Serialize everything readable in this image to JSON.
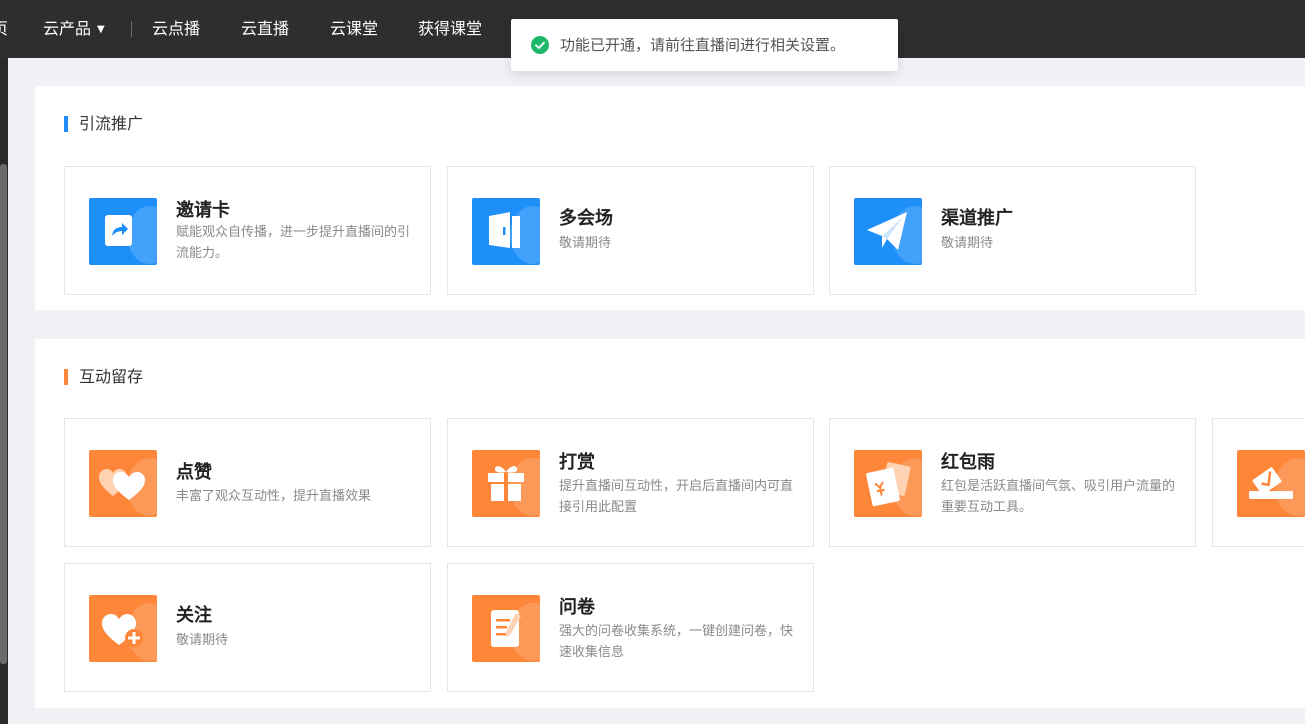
{
  "nav": {
    "items": [
      {
        "label": "页"
      },
      {
        "label": "云产品"
      },
      {
        "label": "云点播"
      },
      {
        "label": "云直播"
      },
      {
        "label": "云课堂"
      },
      {
        "label": "获得课堂"
      }
    ],
    "caret": "▼"
  },
  "toast": {
    "message": "功能已开通，请前往直播间进行相关设置。",
    "icon": "check-circle-icon",
    "color": "#1fb86b"
  },
  "sections": [
    {
      "title": "引流推广",
      "accent": "#1e8ff9",
      "cards": [
        {
          "title": "邀请卡",
          "desc": "赋能观众自传播，进一步提升直播间的引流能力。",
          "icon": "share-card-icon"
        },
        {
          "title": "多会场",
          "desc": "敬请期待",
          "icon": "door-icon"
        },
        {
          "title": "渠道推广",
          "desc": "敬请期待",
          "icon": "paper-plane-icon"
        }
      ]
    },
    {
      "title": "互动留存",
      "accent": "#fd8638",
      "cards": [
        {
          "title": "点赞",
          "desc": "丰富了观众互动性，提升直播效果",
          "icon": "hearts-icon"
        },
        {
          "title": "打赏",
          "desc": "提升直播间互动性，开启后直播间内可直接引用此配置",
          "icon": "gift-icon"
        },
        {
          "title": "红包雨",
          "desc": "红包是活跃直播间气氛、吸引用户流量的重要互动工具。",
          "icon": "red-packet-icon"
        },
        {
          "title": "",
          "desc": "",
          "icon": "ballot-icon"
        },
        {
          "title": "关注",
          "desc": "敬请期待",
          "icon": "heart-plus-icon"
        },
        {
          "title": "问卷",
          "desc": "强大的问卷收集系统，一键创建问卷，快速收集信息",
          "icon": "survey-icon"
        }
      ]
    }
  ]
}
